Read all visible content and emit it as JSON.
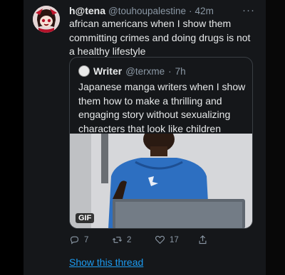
{
  "tweet": {
    "author_name": "h@tena",
    "author_handle": "@touhoupalestine",
    "separator": "·",
    "time": "42m",
    "more_label": "···",
    "text": "african americans when I show them committing crimes and doing drugs is not a healthy lifestyle"
  },
  "quote": {
    "author_name": "Writer",
    "author_handle": "@terxme",
    "separator": "·",
    "time": "7h",
    "text": "Japanese manga writers when I show them how to make a thrilling and engaging story without sexualizing characters that look like children",
    "media_badge": "GIF"
  },
  "actions": {
    "reply_count": "7",
    "retweet_count": "2",
    "like_count": "17",
    "reply_icon": "reply-icon",
    "retweet_icon": "retweet-icon",
    "like_icon": "heart-icon",
    "share_icon": "share-icon"
  },
  "show_thread_label": "Show this thread",
  "colors": {
    "link": "#1d9bf0",
    "muted": "#8b98a5",
    "text": "#e7e9ea",
    "background": "#15171a"
  }
}
